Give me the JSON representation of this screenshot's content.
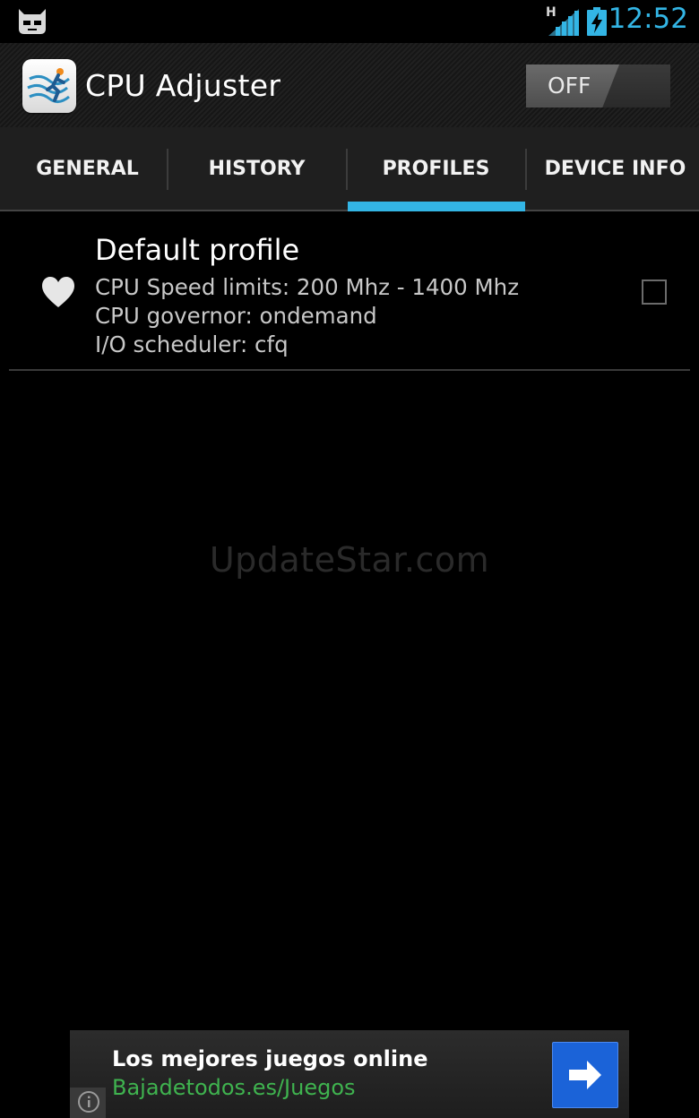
{
  "status_bar": {
    "network_type": "H",
    "time": "12:52",
    "icons": [
      "cyanogenmod-icon",
      "signal-icon",
      "battery-charging-icon"
    ]
  },
  "action_bar": {
    "app_icon": "cpu-adjuster-app-icon",
    "title": "CPU Adjuster",
    "toggle_label": "OFF"
  },
  "tabs": [
    {
      "label": "GENERAL",
      "selected": false
    },
    {
      "label": "HISTORY",
      "selected": false
    },
    {
      "label": "PROFILES",
      "selected": true
    },
    {
      "label": "DEVICE INFO",
      "selected": false
    }
  ],
  "profiles": [
    {
      "icon": "heart-icon",
      "name": "Default profile",
      "speed": "CPU Speed limits: 200 Mhz - 1400 Mhz",
      "governor": "CPU governor: ondemand",
      "scheduler": "I/O scheduler: cfq",
      "checked": false
    }
  ],
  "watermark": "UpdateStar.com",
  "ad": {
    "title": "Los mejores juegos online",
    "url": "Bajadetodos.es/Juegos",
    "button_icon": "arrow-right-icon",
    "info_icon": "info-icon"
  },
  "colors": {
    "accent": "#33b5e5",
    "ad_url": "#3fb34f",
    "ad_button": "#1b63d8"
  }
}
